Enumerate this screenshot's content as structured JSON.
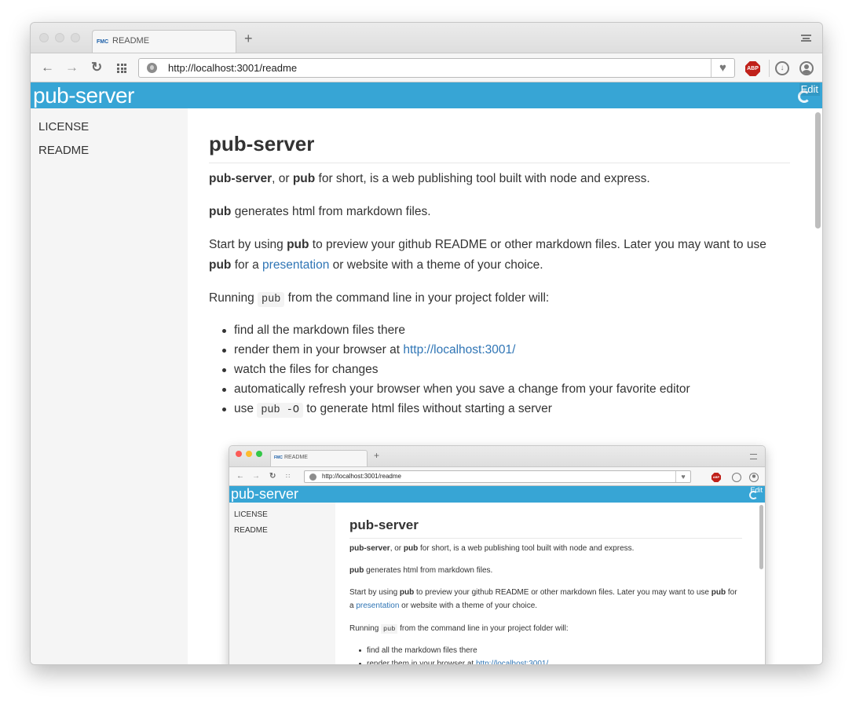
{
  "browser": {
    "tab_title": "README",
    "favicon_text": "FMC",
    "new_tab_label": "+",
    "url": "http://localhost:3001/readme",
    "abp_label": "ABP",
    "icons": [
      "back-arrow-icon",
      "forward-arrow-icon",
      "reload-icon",
      "apps-grid-icon",
      "globe-icon",
      "heart-icon",
      "adblock-icon",
      "download-icon",
      "profile-icon",
      "tab-menu-icon"
    ]
  },
  "site": {
    "brand": "pub-server",
    "edit_label": "Edit",
    "banner_color": "#37a5d5"
  },
  "sidebar": {
    "items": [
      {
        "label": "LICENSE"
      },
      {
        "label": "README"
      }
    ]
  },
  "article": {
    "title": "pub-server",
    "p1_bold1": "pub-server",
    "p1_mid": ", or ",
    "p1_bold2": "pub",
    "p1_rest": " for short, is a web publishing tool built with node and express.",
    "p2_bold": "pub",
    "p2_rest": " generates html from markdown files.",
    "p3_a": "Start by using ",
    "p3_bold1": "pub",
    "p3_b": " to preview your github README or other markdown files. Later you may want to use ",
    "p3_bold2": "pub",
    "p3_c": " for a ",
    "p3_link": "presentation",
    "p3_d": " or website with a theme of your choice.",
    "p4_a": "Running ",
    "p4_code": "pub",
    "p4_b": " from the command line in your project folder will:",
    "list": {
      "item1": "find all the markdown files there",
      "item2_a": "render them in your browser at ",
      "item2_link": "http://localhost:3001/",
      "item3": "watch the files for changes",
      "item4": "automatically refresh your browser when you save a change from your favorite editor",
      "item5_a": "use ",
      "item5_code": "pub -O",
      "item5_b": " to generate html files without starting a server"
    }
  },
  "link_color": "#2f75b5"
}
